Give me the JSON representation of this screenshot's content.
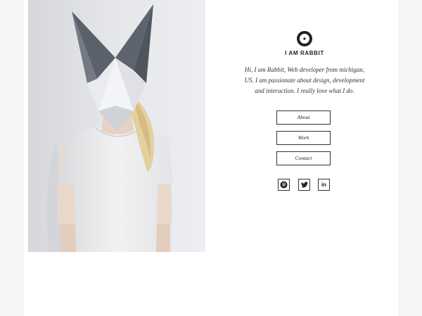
{
  "brand": {
    "logo_icon": "circle-logo-icon",
    "name": "I AM RABBIT"
  },
  "intro": {
    "line1": "Hi, I am Rabbit, Web developer from michigan,",
    "line2": "US. I am passionate about design, development",
    "line3": "and interaction. I really love what I do."
  },
  "nav": {
    "about": "About",
    "work": "Work",
    "contact": "Contact"
  },
  "social": [
    {
      "name": "Pinterest",
      "icon": "pinterest-icon"
    },
    {
      "name": "Twitter",
      "icon": "twitter-icon"
    },
    {
      "name": "LinkedIn",
      "icon": "linkedin-icon",
      "glyph": "in"
    }
  ],
  "colors": {
    "page_bg": "#ffffff",
    "outer_bg": "#f5f5f5",
    "text": "#222222",
    "mask_dark": "#5b616a"
  },
  "hero_image": {
    "subject": "person-wearing-paper-rabbit-mask-photo"
  }
}
